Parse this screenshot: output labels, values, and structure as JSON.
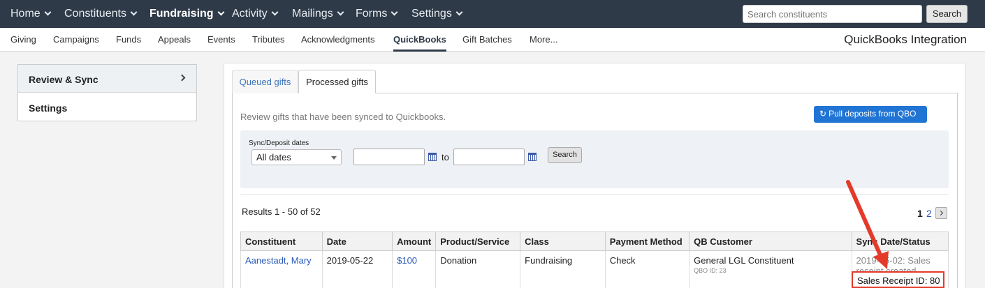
{
  "topnav": {
    "items": [
      {
        "label": "Home"
      },
      {
        "label": "Constituents"
      },
      {
        "label": "Fundraising"
      },
      {
        "label": "Activity"
      },
      {
        "label": "Mailings"
      },
      {
        "label": "Forms"
      },
      {
        "label": "Settings"
      }
    ],
    "search_placeholder": "Search constituents",
    "search_button": "Search"
  },
  "subnav": {
    "items": [
      {
        "label": "Giving"
      },
      {
        "label": "Campaigns"
      },
      {
        "label": "Funds"
      },
      {
        "label": "Appeals"
      },
      {
        "label": "Events"
      },
      {
        "label": "Tributes"
      },
      {
        "label": "Acknowledgments"
      },
      {
        "label": "QuickBooks"
      },
      {
        "label": "Gift Batches"
      },
      {
        "label": "More..."
      }
    ],
    "page_title": "QuickBooks Integration"
  },
  "sidebar": {
    "items": [
      {
        "label": "Review & Sync"
      },
      {
        "label": "Settings"
      }
    ]
  },
  "main": {
    "tabs": [
      {
        "label": "Queued gifts"
      },
      {
        "label": "Processed gifts"
      }
    ],
    "description": "Review gifts that have been synced to Quickbooks.",
    "pull_button": "Pull deposits from QBO",
    "filter": {
      "label": "Sync/Deposit dates",
      "selected": "All dates",
      "to_label": "to",
      "search_button": "Search"
    },
    "results": "Results 1 - 50 of 52",
    "pager": {
      "current": "1",
      "next_page": "2"
    },
    "table": {
      "headers": [
        "Constituent",
        "Date",
        "Amount",
        "Product/Service",
        "Class",
        "Payment Method",
        "QB Customer",
        "Sync Date/Status"
      ],
      "rows": [
        {
          "constituent": "Aanestadt, Mary",
          "date": "2019-05-22",
          "amount": "$100",
          "product": "Donation",
          "class": "Fundraising",
          "payment": "Check",
          "qb_customer": "General LGL Constituent",
          "qb_id": "QBO ID: 23",
          "sync_status": "2019-05-02: Sales receipt created",
          "receipt": "Sales Receipt ID: 80"
        }
      ]
    }
  },
  "colors": {
    "nav_bg": "#2e3a48",
    "primary_button": "#2074d4",
    "link": "#2a5ab8",
    "annotation": "#e43a2a"
  }
}
